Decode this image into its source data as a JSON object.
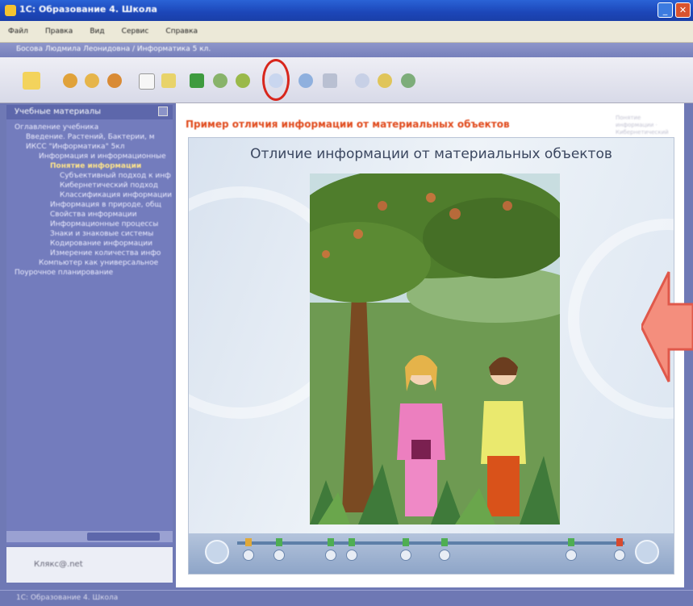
{
  "window": {
    "title": "1С: Образование 4. Школа"
  },
  "menu": [
    "Файл",
    "Правка",
    "Вид",
    "Сервис",
    "Справка"
  ],
  "breadcrumb": "Босова Людмила Леонидовна / Информатика 5 кл.",
  "toolbar": {
    "icons": [
      "home-icon",
      "back-icon",
      "refresh-icon",
      "forward-icon",
      "page-icon",
      "bookmark-icon",
      "book-icon",
      "search-icon",
      "notes-icon",
      "magnifier-icon",
      "audio-icon",
      "print-icon",
      "help-icon",
      "info-icon",
      "settings-icon"
    ],
    "highlight_color": "#d8261c"
  },
  "sidebar": {
    "header": "Учебные материалы",
    "tree": [
      "Оглавление учебника",
      "Введение. Растений, Бактерии, м",
      "ИКСС \"Информатика\" 5кл",
      "Информация и информационные",
      "Понятие информации",
      "Субъективный подход к инф",
      "Кибернетический подход",
      "Классификация информации",
      "Информация в природе, общ",
      "Свойства информации",
      "Информационные процессы",
      "Знаки и знаковые системы",
      "Кодирование информации",
      "Измерение количества инфо",
      "Компьютер как универсальное",
      "Поурочное планирование"
    ],
    "logo": "Клякс@.net"
  },
  "content": {
    "heading": "Пример отличия информации от материальных объектов",
    "side_note": "Понятие информации · Кибернетический подход",
    "slide_title": "Отличие информации от материальных объектов"
  },
  "statusbar": "1С: Образование 4. Школа",
  "colors": {
    "accent_arrow": "#f08a7a",
    "heading": "#e04a1c"
  }
}
